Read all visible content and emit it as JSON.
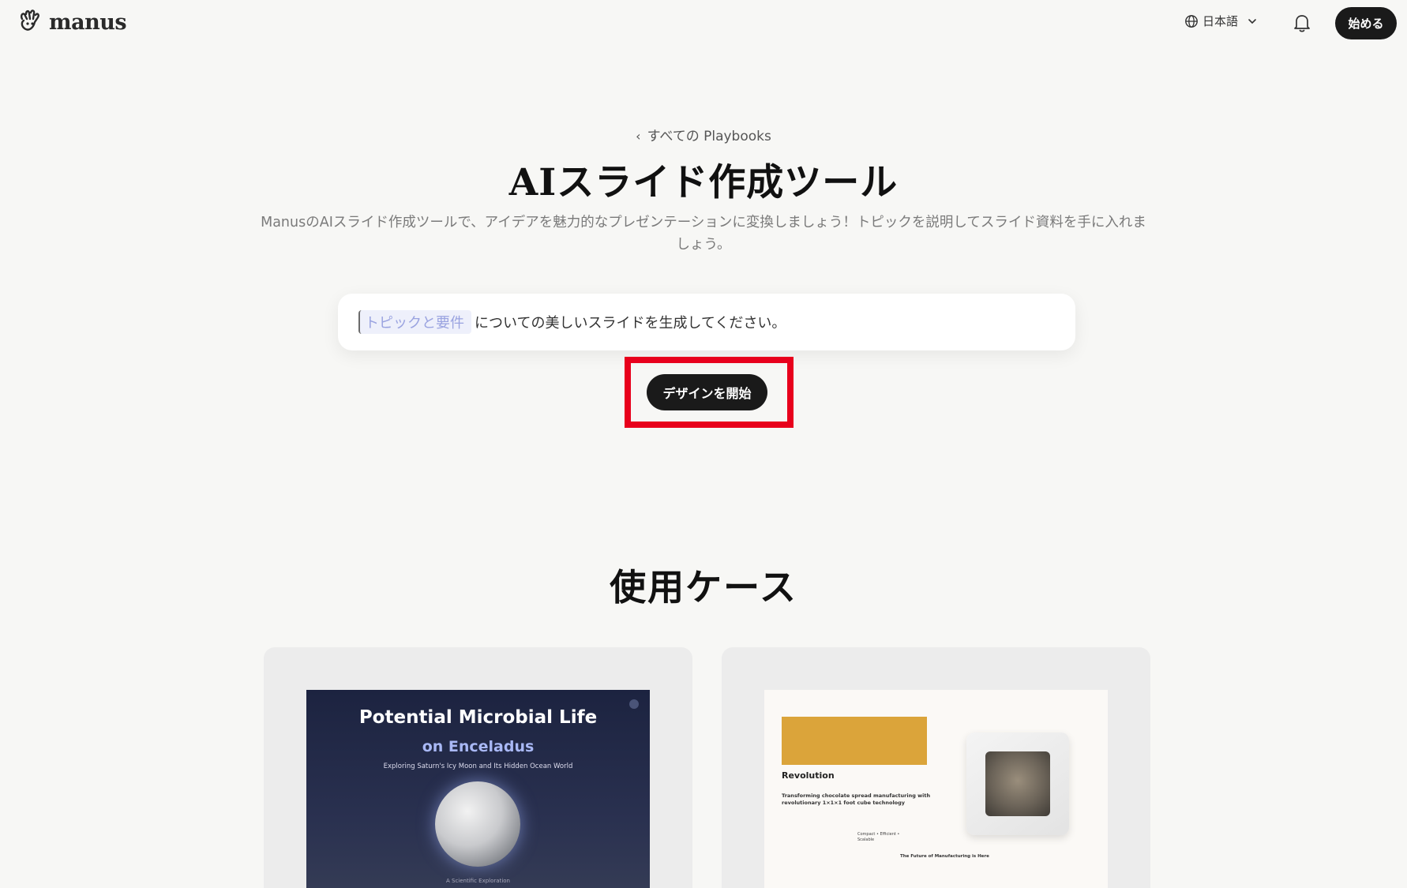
{
  "header": {
    "logo_text": "manus",
    "language_label": "日本語",
    "start_label": "始める"
  },
  "hero": {
    "back_label": "すべての Playbooks",
    "title": "AIスライド作成ツール",
    "subtitle": "ManusのAIスライド作成ツールで、アイデアを魅力的なプレゼンテーションに変換しましょう！トピックを説明してスライド資料を手に入れましょう。",
    "prompt_chip": "トピックと要件",
    "prompt_text": "についての美しいスライドを生成してください。",
    "design_button": "デザインを開始"
  },
  "use_cases": {
    "title": "使用ケース",
    "cards": [
      {
        "slide_title": "Potential Microbial Life",
        "slide_subtitle": "on Enceladus",
        "slide_desc": "Exploring Saturn's Icy Moon and Its Hidden Ocean World",
        "slide_footer": "A Scientific Exploration"
      },
      {
        "slide_heading": "Revolution",
        "slide_desc": "Transforming chocolate spread manufacturing with revolutionary 1×1×1 foot cube technology",
        "slide_tags": "Compact • Efficient • Scalable",
        "slide_footer": "The Future of Manufacturing is Here"
      }
    ]
  },
  "colors": {
    "background": "#f7f7f5",
    "primary_button": "#1a1a1a",
    "highlight": "#e8001c",
    "chip_text": "#9aa3e0",
    "gold": "#dba43a"
  }
}
